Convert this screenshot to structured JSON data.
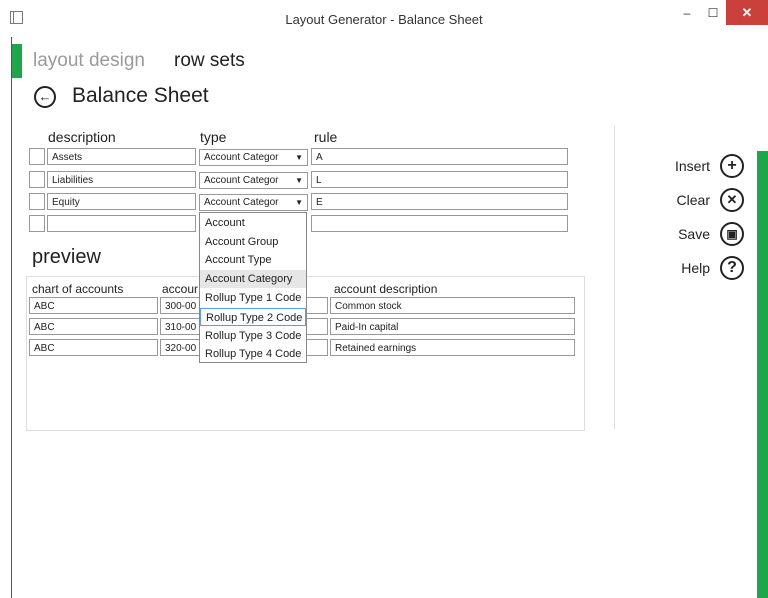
{
  "window": {
    "title": "Layout Generator - Balance Sheet",
    "minimize_glyph": "–",
    "maximize_glyph": "☐",
    "close_glyph": "✕"
  },
  "nav": {
    "tabs": [
      {
        "label": "layout design"
      },
      {
        "label": "row sets"
      }
    ]
  },
  "page": {
    "title": "Balance Sheet",
    "back_glyph": "←"
  },
  "rows_table": {
    "headers": {
      "description": "description",
      "type": "type",
      "rule": "rule"
    },
    "rows": [
      {
        "description": "Assets",
        "type": "Account Categor",
        "rule": "A"
      },
      {
        "description": "Liabilities",
        "type": "Account Categor",
        "rule": "L"
      },
      {
        "description": "Equity",
        "type": "Account Categor",
        "rule": "E"
      },
      {
        "description": "",
        "type": "",
        "rule": ""
      }
    ]
  },
  "type_dropdown": {
    "arrow_glyph": "▼",
    "options": [
      "Account",
      "Account Group",
      "Account Type",
      "Account Category",
      "Rollup Type 1 Code",
      "Rollup Type 2 Code",
      "Rollup Type 3 Code",
      "Rollup Type 4 Code"
    ],
    "selected": "Account Category",
    "hovered": "Rollup Type 2 Code"
  },
  "preview": {
    "title": "preview",
    "headers": {
      "chart": "chart of accounts",
      "account": "accour",
      "description": "account description"
    },
    "rows": [
      {
        "chart": "ABC",
        "account": "300-00",
        "description": "Common stock"
      },
      {
        "chart": "ABC",
        "account": "310-00",
        "description": "Paid-In capital"
      },
      {
        "chart": "ABC",
        "account": "320-00",
        "description": "Retained earnings"
      }
    ]
  },
  "actions": [
    {
      "label": "Insert",
      "glyph": "+"
    },
    {
      "label": "Clear",
      "glyph": "✕"
    },
    {
      "label": "Save",
      "glyph": "▣"
    },
    {
      "label": "Help",
      "glyph": "?"
    }
  ],
  "colors": {
    "accent": "#1ea64b",
    "close": "#c9413a"
  }
}
